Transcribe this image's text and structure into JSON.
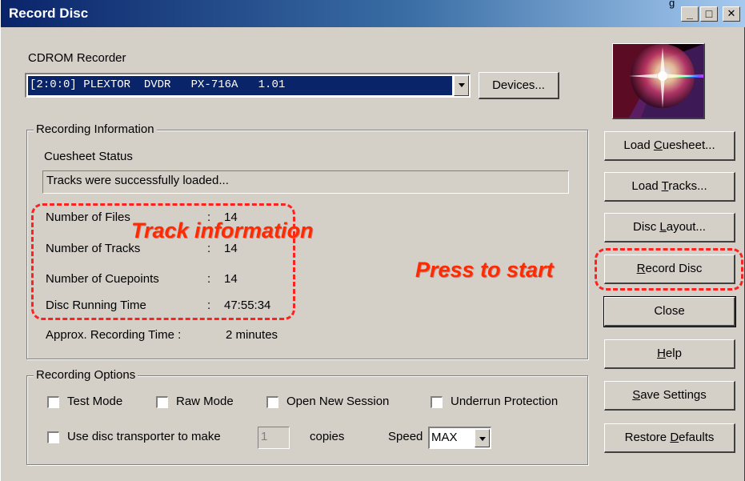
{
  "window": {
    "title": "Record Disc",
    "top_caption": "g",
    "controls": {
      "minimize": "_",
      "maximize": "□",
      "close": "✕"
    }
  },
  "recorder": {
    "label": "CDROM Recorder",
    "selected": "[2:0:0] PLEXTOR  DVDR   PX-716A   1.01",
    "devices_button": "Devices..."
  },
  "recording_info": {
    "group_title": "Recording Information",
    "cuesheet_status_label": "Cuesheet Status",
    "cuesheet_status_value": "Tracks were successfully loaded...",
    "rows": [
      {
        "label": "Number of Files",
        "sep": ":",
        "value": "14"
      },
      {
        "label": "Number of Tracks",
        "sep": ":",
        "value": "14"
      },
      {
        "label": "Number of Cuepoints",
        "sep": ":",
        "value": "14"
      },
      {
        "label": "Disc Running Time",
        "sep": ":",
        "value": "47:55:34"
      }
    ],
    "approx_label": "Approx. Recording Time :",
    "approx_value": "2 minutes"
  },
  "recording_options": {
    "group_title": "Recording Options",
    "checkboxes": [
      {
        "label": "Test Mode",
        "checked": false
      },
      {
        "label": "Raw Mode",
        "checked": false
      },
      {
        "label": "Open New Session",
        "checked": false
      },
      {
        "label": "Underrun Protection",
        "checked": false
      }
    ],
    "transporter": {
      "label": "Use disc transporter to make",
      "copies_value": "1",
      "copies_label": "copies",
      "checked": false
    },
    "speed": {
      "label": "Speed",
      "value": "MAX"
    }
  },
  "buttons": {
    "load_cuesheet": {
      "pre": "Load ",
      "accel": "C",
      "post": "uesheet..."
    },
    "load_tracks": {
      "pre": "Load ",
      "accel": "T",
      "post": "racks..."
    },
    "disc_layout": {
      "pre": "Disc ",
      "accel": "L",
      "post": "ayout..."
    },
    "record_disc": {
      "pre": "",
      "accel": "R",
      "post": "ecord Disc"
    },
    "close": "Close",
    "help": {
      "pre": "",
      "accel": "H",
      "post": "elp"
    },
    "save_settings": {
      "pre": "",
      "accel": "S",
      "post": "ave Settings"
    },
    "restore_defaults": {
      "pre": "Restore ",
      "accel": "D",
      "post": "efaults"
    }
  },
  "annotations": {
    "track_information": "Track information",
    "press_to_start": "Press to start",
    "color": "#ff2a00"
  }
}
